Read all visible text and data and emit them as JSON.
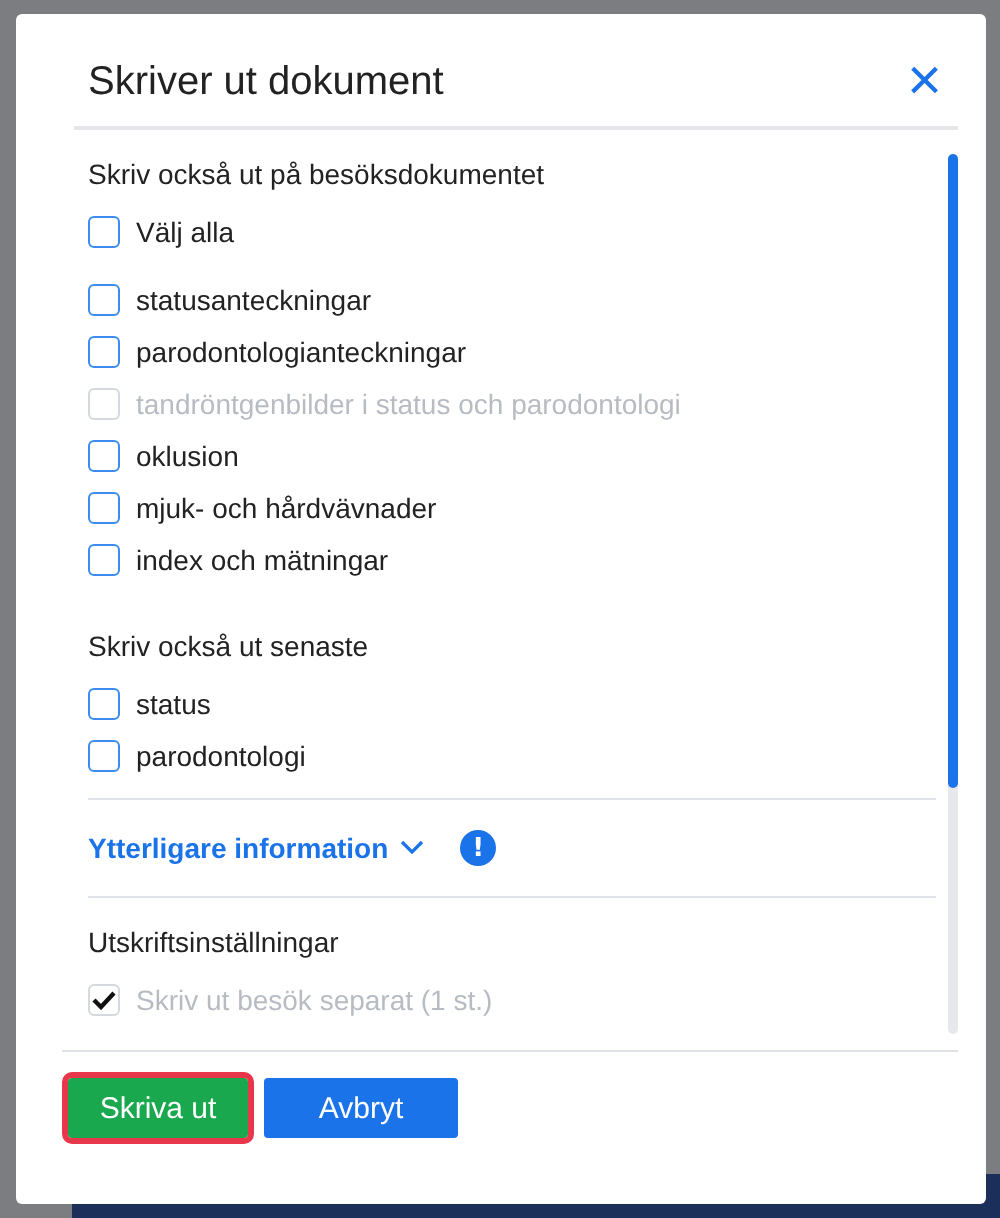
{
  "dialog": {
    "title": "Skriver ut dokument",
    "close": "×",
    "sections": [
      {
        "heading": "Skriv också ut på besöksdokumentet",
        "items": [
          {
            "label": "Välj alla",
            "checked": false,
            "disabled": false,
            "kind": "select_all"
          },
          {
            "label": "statusanteckningar",
            "checked": false,
            "disabled": false
          },
          {
            "label": "parodontologianteckningar",
            "checked": false,
            "disabled": false
          },
          {
            "label": "tandröntgenbilder i status och parodontologi",
            "checked": false,
            "disabled": true
          },
          {
            "label": "oklusion",
            "checked": false,
            "disabled": false
          },
          {
            "label": "mjuk- och hårdvävnader",
            "checked": false,
            "disabled": false
          },
          {
            "label": "index och mätningar",
            "checked": false,
            "disabled": false
          }
        ]
      },
      {
        "heading": "Skriv också ut senaste",
        "items": [
          {
            "label": "status",
            "checked": false,
            "disabled": false
          },
          {
            "label": "parodontologi",
            "checked": false,
            "disabled": false
          }
        ]
      }
    ],
    "more_info": {
      "label": "Ytterligare information",
      "expanded": false,
      "alert": "!"
    },
    "settings": {
      "heading": "Utskriftsinställningar",
      "items": [
        {
          "label": "Skriv ut besök separat (1 st.)",
          "checked": true,
          "disabled": true
        }
      ]
    },
    "buttons": [
      {
        "label": "Skriva ut",
        "kind": "primary",
        "focused": true
      },
      {
        "label": "Avbryt",
        "kind": "secondary",
        "focused": false
      }
    ]
  }
}
